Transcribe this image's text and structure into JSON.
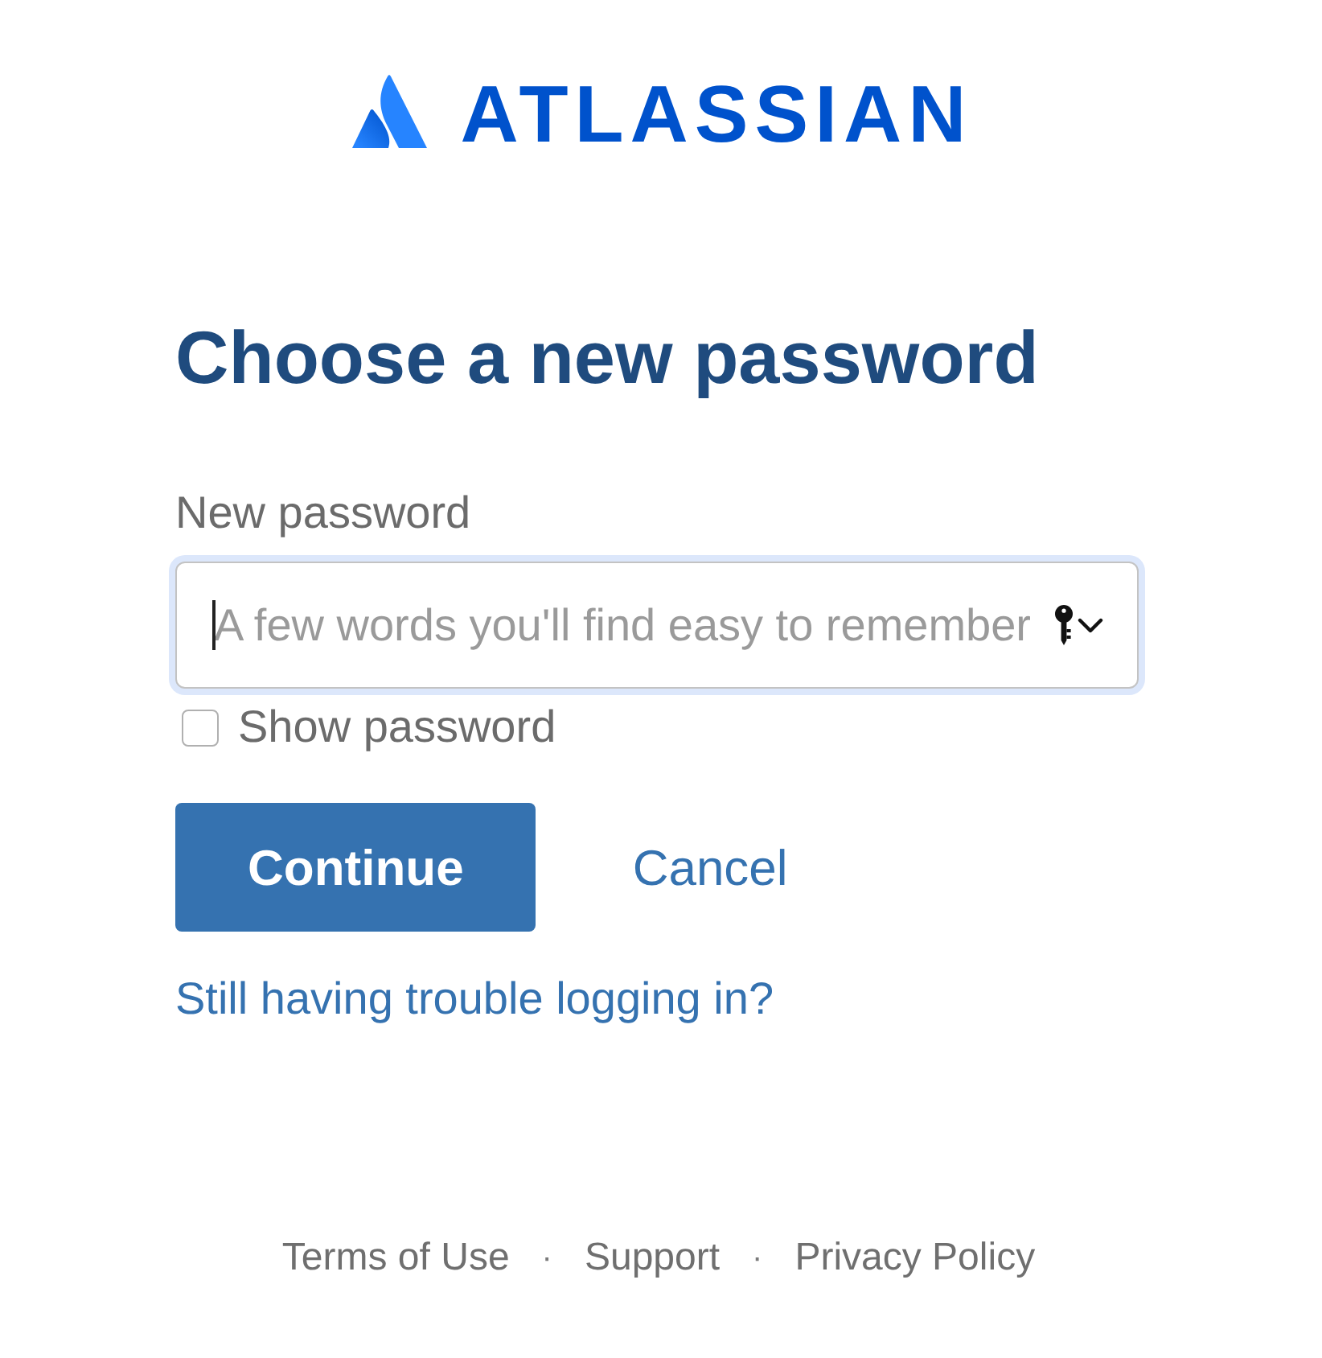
{
  "logo": {
    "wordmark": "ATLASSIAN"
  },
  "heading": "Choose a new password",
  "password_field": {
    "label": "New password",
    "placeholder": "A few words you'll find easy to remember",
    "focused": true
  },
  "show_password": {
    "label": "Show password",
    "checked": false
  },
  "buttons": [
    {
      "kind": "primary",
      "label": "Continue"
    },
    {
      "kind": "link",
      "label": "Cancel"
    }
  ],
  "help_link": "Still having trouble logging in?",
  "footer": [
    {
      "kind": "link",
      "text": "Terms of Use"
    },
    {
      "kind": "separator",
      "text": "·"
    },
    {
      "kind": "link",
      "text": "Support"
    },
    {
      "kind": "separator",
      "text": "·"
    },
    {
      "kind": "link",
      "text": "Privacy Policy"
    }
  ]
}
